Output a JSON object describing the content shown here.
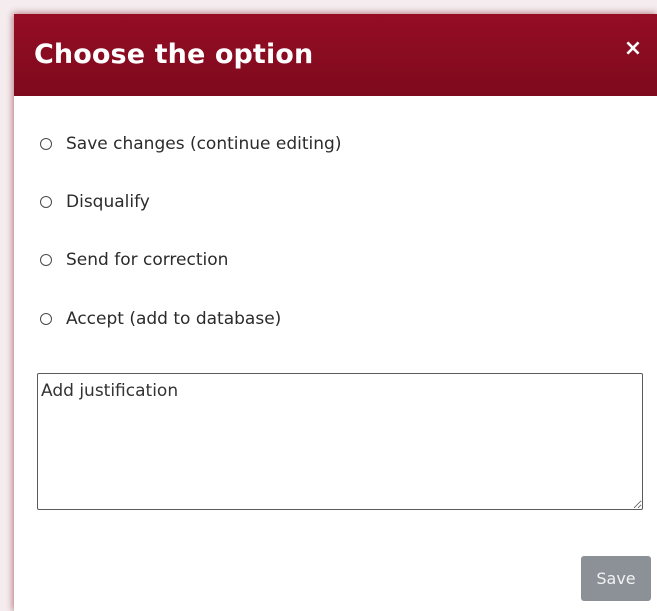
{
  "dialog": {
    "title": "Choose the option",
    "close_label": "×"
  },
  "options": [
    {
      "label": "Save changes (continue editing)",
      "selected": false
    },
    {
      "label": "Disqualify",
      "selected": false
    },
    {
      "label": "Send for correction",
      "selected": false
    },
    {
      "label": "Accept (add to database)",
      "selected": false
    }
  ],
  "justification": {
    "placeholder": "Add justification",
    "value": ""
  },
  "footer": {
    "save_label": "Save"
  },
  "colors": {
    "header": "#8a0b20",
    "save_button": "#8b9196"
  }
}
